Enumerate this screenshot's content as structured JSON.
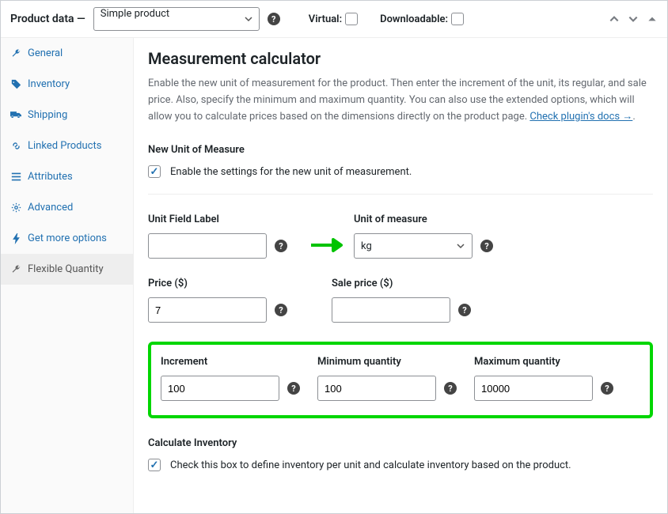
{
  "header": {
    "title": "Product data —",
    "product_type": "Simple product",
    "virtual_label": "Virtual:",
    "downloadable_label": "Downloadable:"
  },
  "sidebar": {
    "items": [
      {
        "label": "General",
        "icon": "wrench"
      },
      {
        "label": "Inventory",
        "icon": "tag"
      },
      {
        "label": "Shipping",
        "icon": "truck"
      },
      {
        "label": "Linked Products",
        "icon": "link"
      },
      {
        "label": "Attributes",
        "icon": "list"
      },
      {
        "label": "Advanced",
        "icon": "gear"
      },
      {
        "label": "Get more options",
        "icon": "bolt"
      },
      {
        "label": "Flexible Quantity",
        "icon": "wrench-gray"
      }
    ]
  },
  "main": {
    "title": "Measurement calculator",
    "desc_before": "Enable the new unit of measurement for the product. Then enter the increment of the unit, its regular, and sale price. Also, specify the minimum and maximum quantity. You can also use the extended options, which will allow you to calculate prices based on the dimensions directly on the product page. ",
    "docs_link": "Check plugin's docs →",
    "new_unit_heading": "New Unit of Measure",
    "enable_label": "Enable the settings for the new unit of measurement.",
    "fields": {
      "unit_field_label": {
        "label": "Unit Field Label",
        "value": ""
      },
      "unit_of_measure": {
        "label": "Unit of measure",
        "value": "kg"
      },
      "price": {
        "label": "Price ($)",
        "value": "7"
      },
      "sale_price": {
        "label": "Sale price ($)",
        "value": ""
      },
      "increment": {
        "label": "Increment",
        "value": "100"
      },
      "min_qty": {
        "label": "Minimum quantity",
        "value": "100"
      },
      "max_qty": {
        "label": "Maximum quantity",
        "value": "10000"
      }
    },
    "calc_inventory_heading": "Calculate Inventory",
    "calc_inventory_label": "Check this box to define inventory per unit and calculate inventory based on the product."
  }
}
